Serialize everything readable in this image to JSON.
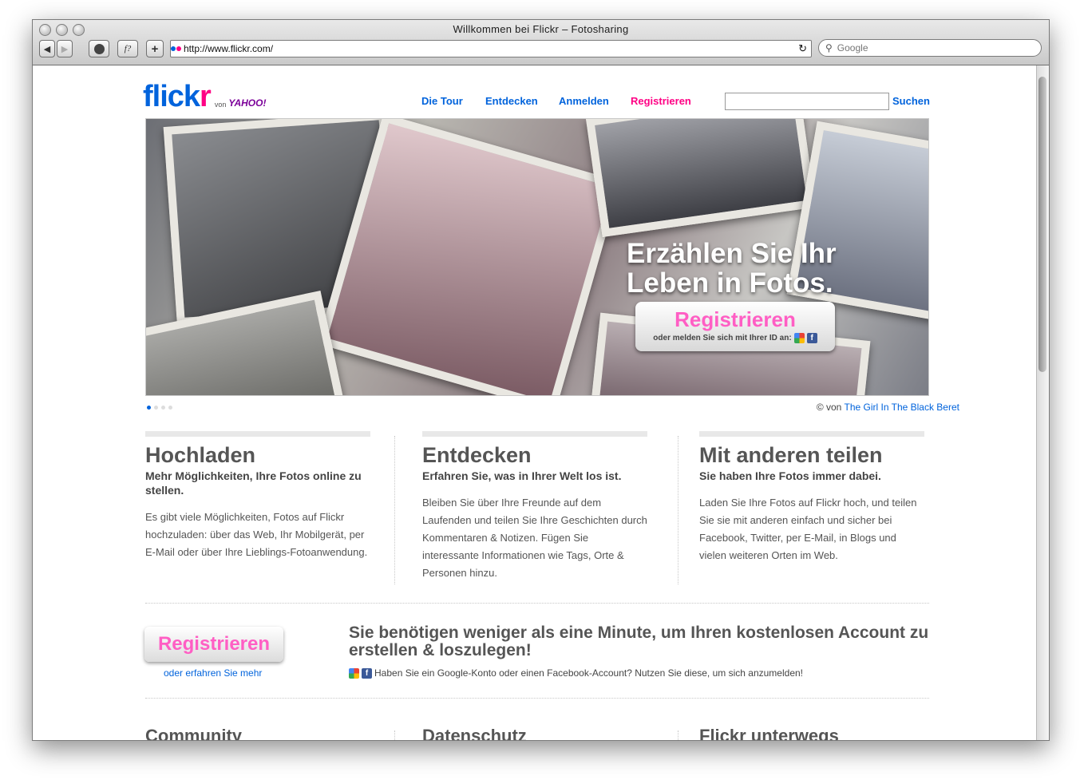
{
  "window": {
    "title": "Willkommen bei Flickr – Fotosharing"
  },
  "toolbar": {
    "back_icon": "◀",
    "forward_icon": "▶",
    "add_icon": "+",
    "font_icon": "f?",
    "url": "http://www.flickr.com/",
    "reload_icon": "↻",
    "search_placeholder": "Google"
  },
  "header": {
    "logo_fl": "flick",
    "logo_r": "r",
    "logo_by": "von",
    "logo_yahoo": "YAHOO!",
    "nav": [
      "Die Tour",
      "Entdecken",
      "Anmelden",
      "Registrieren"
    ],
    "search_button": "Suchen"
  },
  "hero": {
    "headline_line1": "Erzählen Sie Ihr",
    "headline_line2": "Leben in Fotos.",
    "button": "Registrieren",
    "subline": "oder melden Sie sich mit Ihrer ID an:",
    "credit_prefix": "© von",
    "credit_link": "The Girl In The Black Beret"
  },
  "columns": [
    {
      "title": "Hochladen",
      "subtitle": "Mehr Möglichkeiten, Ihre Fotos online zu stellen.",
      "text": "Es gibt viele Möglichkeiten, Fotos auf Flickr hochzuladen: über das Web, Ihr Mobilgerät, per E-Mail oder über Ihre Lieblings-Fotoanwendung."
    },
    {
      "title": "Entdecken",
      "subtitle": "Erfahren Sie, was in Ihrer Welt los ist.",
      "text": "Bleiben Sie über Ihre Freunde auf dem Laufenden und teilen Sie Ihre Geschichten durch Kommentaren & Notizen. Fügen Sie interessante Informationen wie Tags, Orte & Personen hinzu."
    },
    {
      "title": "Mit anderen teilen",
      "subtitle": "Sie haben Ihre Fotos immer dabei.",
      "text": "Laden Sie Ihre Fotos auf Flickr hoch, und teilen Sie sie mit anderen einfach und sicher bei Facebook, Twitter, per E-Mail, in Blogs und vielen weiteren Orten im Web."
    }
  ],
  "cta": {
    "button": "Registrieren",
    "learn_more": "oder erfahren Sie mehr",
    "headline": "Sie benötigen weniger als eine Minute, um Ihren kostenlosen Account zu erstellen & loszulegen!",
    "note": "Haben Sie ein Google-Konto oder einen Facebook-Account? Nutzen Sie diese, um sich anzumelden!"
  },
  "bottom": [
    "Community",
    "Datenschutz",
    "Flickr unterwegs"
  ]
}
